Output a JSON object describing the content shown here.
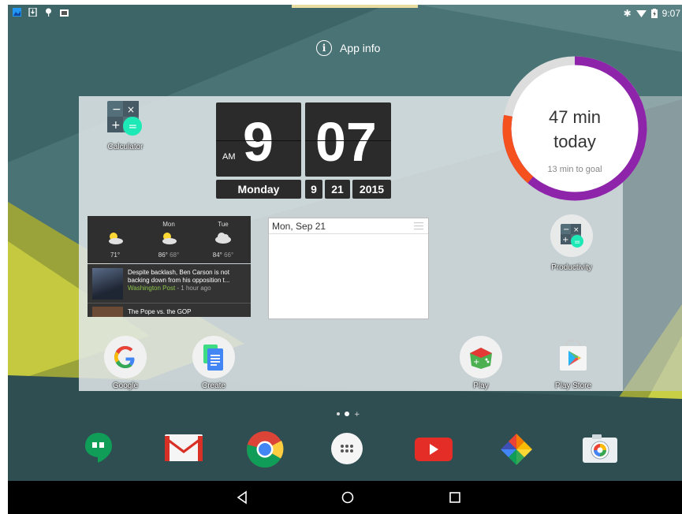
{
  "status_bar": {
    "time": "9:07"
  },
  "app_info": {
    "label": "App info"
  },
  "fit_widget": {
    "minutes": "47 min",
    "period": "today",
    "goal": "13 min to goal",
    "progress_fraction": 0.78,
    "track_color": "#8e24aa",
    "accent_color": "#f4511e"
  },
  "calculator": {
    "label": "Calculator"
  },
  "clock": {
    "hour": "9",
    "minute": "07",
    "ampm": "AM",
    "day": "Monday",
    "month": "9",
    "date": "21",
    "year": "2015"
  },
  "weather": {
    "days": [
      {
        "name": "",
        "high": "71°",
        "low": "",
        "icon": "sun-cloud-icon"
      },
      {
        "name": "Mon",
        "high": "86°",
        "low": "68°",
        "icon": "sun-cloud-icon"
      },
      {
        "name": "Tue",
        "high": "84°",
        "low": "66°",
        "icon": "cloud-icon"
      }
    ]
  },
  "news": {
    "headline": "Despite backlash, Ben Carson is not backing down from his opposition t...",
    "source": "Washington Post",
    "age": " - 1 hour ago",
    "headline2": "The Pope vs. the GOP"
  },
  "agenda": {
    "date": "Mon, Sep 21"
  },
  "productivity": {
    "label": "Productivity"
  },
  "home_apps": [
    {
      "label": "Google",
      "icon": "google-icon"
    },
    {
      "label": "Create",
      "icon": "docs-icon"
    },
    {
      "label": "Play",
      "icon": "play-games-icon"
    },
    {
      "label": "Play Store",
      "icon": "play-store-icon"
    }
  ],
  "dock": [
    "hangouts-icon",
    "gmail-icon",
    "chrome-icon",
    "apps-drawer-icon",
    "youtube-icon",
    "photos-icon",
    "camera-icon"
  ]
}
